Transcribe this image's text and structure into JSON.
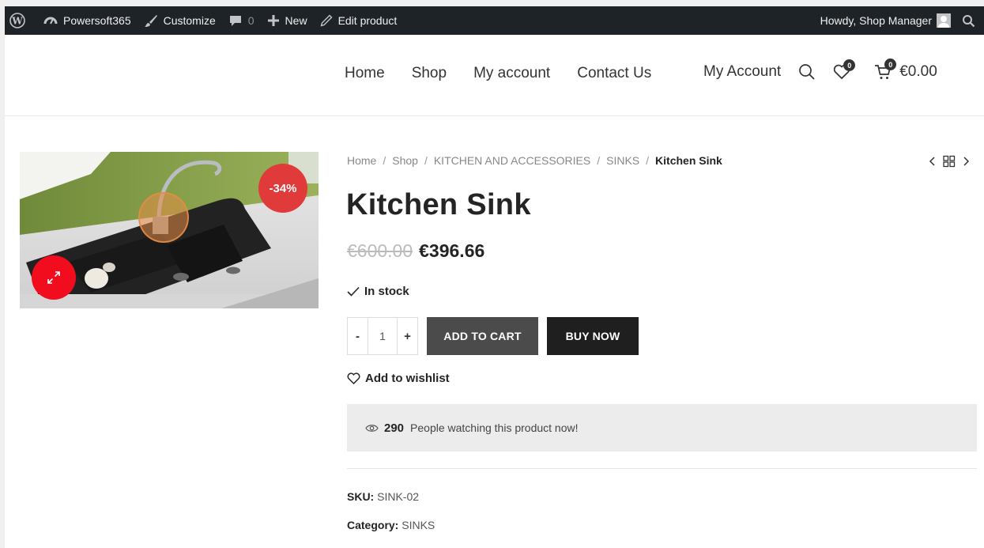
{
  "adminbar": {
    "site_name": "Powersoft365",
    "customize": "Customize",
    "comments_count": "0",
    "new_label": "New",
    "edit_label": "Edit product",
    "howdy": "Howdy, Shop Manager",
    "icons": [
      "wordpress-icon",
      "dashboard-icon",
      "brush-icon",
      "comment-icon",
      "plus-icon",
      "pencil-icon",
      "search-icon"
    ]
  },
  "nav": {
    "items": [
      "Home",
      "Shop",
      "My account",
      "Contact Us"
    ],
    "my_account": "My Account",
    "wishlist_count": "0",
    "cart_count": "0",
    "cart_total": "€0.00"
  },
  "product": {
    "breadcrumb": [
      "Home",
      "Shop",
      "KITCHEN AND ACCESSORIES",
      "SINKS",
      "Kitchen Sink"
    ],
    "title": "Kitchen Sink",
    "old_price": "€600.00",
    "price": "€396.66",
    "discount_badge": "-34%",
    "stock": "In stock",
    "quantity": "1",
    "qty_minus": "-",
    "qty_plus": "+",
    "add_to_cart": "ADD TO CART",
    "buy_now": "BUY NOW",
    "wishlist": "Add to wishlist",
    "watching_count": "290",
    "watching_text": "People watching this product now!",
    "sku_label": "SKU:",
    "sku": "SINK-02",
    "category_label": "Category:",
    "category": "SINKS"
  },
  "colors": {
    "adminbar_bg": "#1d2327",
    "sale_badge": "#e03a3a",
    "zoom_button": "#f10d1d",
    "add_to_cart_bg": "#4b4b4b",
    "buy_now_bg": "#1f1f1f"
  }
}
